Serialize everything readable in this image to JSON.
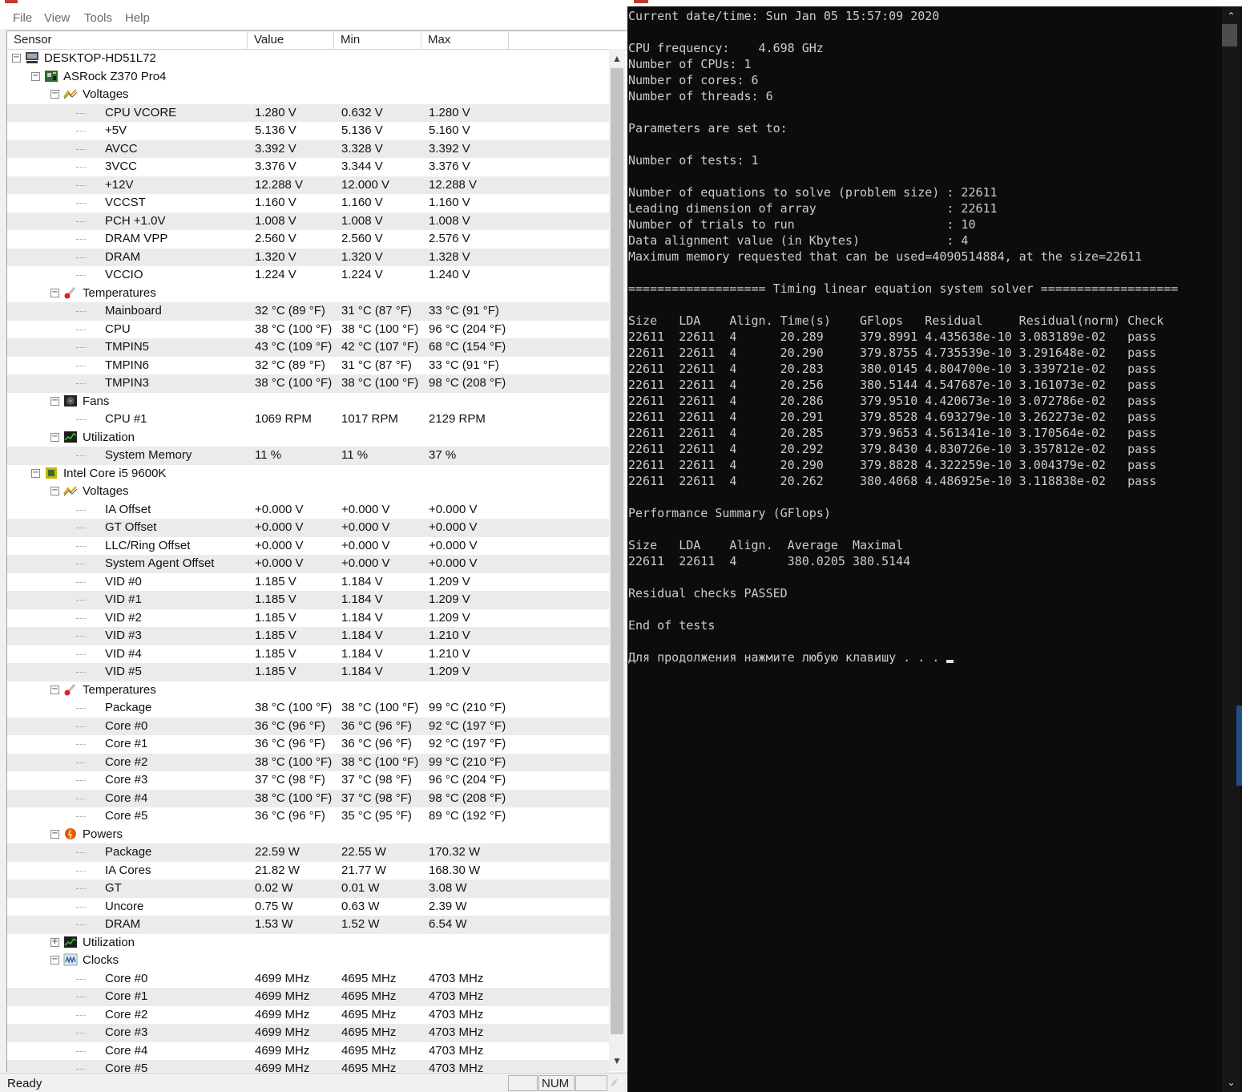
{
  "menu": [
    "File",
    "View",
    "Tools",
    "Help"
  ],
  "columns": [
    "Sensor",
    "Value",
    "Min",
    "Max"
  ],
  "rows": [
    {
      "level": 0,
      "kind": "group",
      "label": "DESKTOP-HD51L72",
      "icon": "computer-icon",
      "expander": "−"
    },
    {
      "level": 1,
      "kind": "group",
      "label": "ASRock Z370 Pro4",
      "icon": "motherboard-icon",
      "expander": "−"
    },
    {
      "level": 2,
      "kind": "group",
      "label": "Voltages",
      "icon": "voltage-icon",
      "expander": "−"
    },
    {
      "level": 3,
      "label": "CPU VCORE",
      "value": "1.280 V",
      "min": "0.632 V",
      "max": "1.280 V"
    },
    {
      "level": 3,
      "label": "+5V",
      "value": "5.136 V",
      "min": "5.136 V",
      "max": "5.160 V"
    },
    {
      "level": 3,
      "label": "AVCC",
      "value": "3.392 V",
      "min": "3.328 V",
      "max": "3.392 V"
    },
    {
      "level": 3,
      "label": "3VCC",
      "value": "3.376 V",
      "min": "3.344 V",
      "max": "3.376 V"
    },
    {
      "level": 3,
      "label": "+12V",
      "value": "12.288 V",
      "min": "12.000 V",
      "max": "12.288 V"
    },
    {
      "level": 3,
      "label": "VCCST",
      "value": "1.160 V",
      "min": "1.160 V",
      "max": "1.160 V"
    },
    {
      "level": 3,
      "label": "PCH +1.0V",
      "value": "1.008 V",
      "min": "1.008 V",
      "max": "1.008 V"
    },
    {
      "level": 3,
      "label": "DRAM VPP",
      "value": "2.560 V",
      "min": "2.560 V",
      "max": "2.576 V"
    },
    {
      "level": 3,
      "label": "DRAM",
      "value": "1.320 V",
      "min": "1.320 V",
      "max": "1.328 V"
    },
    {
      "level": 3,
      "label": "VCCIO",
      "value": "1.224 V",
      "min": "1.224 V",
      "max": "1.240 V"
    },
    {
      "level": 2,
      "kind": "group",
      "label": "Temperatures",
      "icon": "thermometer-icon",
      "expander": "−"
    },
    {
      "level": 3,
      "label": "Mainboard",
      "value": "32 °C  (89 °F)",
      "min": "31 °C  (87 °F)",
      "max": "33 °C  (91 °F)"
    },
    {
      "level": 3,
      "label": "CPU",
      "value": "38 °C  (100 °F)",
      "min": "38 °C  (100 °F)",
      "max": "96 °C  (204 °F)"
    },
    {
      "level": 3,
      "label": "TMPIN5",
      "value": "43 °C  (109 °F)",
      "min": "42 °C  (107 °F)",
      "max": "68 °C  (154 °F)"
    },
    {
      "level": 3,
      "label": "TMPIN6",
      "value": "32 °C  (89 °F)",
      "min": "31 °C  (87 °F)",
      "max": "33 °C  (91 °F)"
    },
    {
      "level": 3,
      "label": "TMPIN3",
      "value": "38 °C  (100 °F)",
      "min": "38 °C  (100 °F)",
      "max": "98 °C  (208 °F)"
    },
    {
      "level": 2,
      "kind": "group",
      "label": "Fans",
      "icon": "fan-icon",
      "expander": "−"
    },
    {
      "level": 3,
      "label": "CPU #1",
      "value": "1069 RPM",
      "min": "1017 RPM",
      "max": "2129 RPM"
    },
    {
      "level": 2,
      "kind": "group",
      "label": "Utilization",
      "icon": "utilization-icon",
      "expander": "−"
    },
    {
      "level": 3,
      "label": "System Memory",
      "value": "11 %",
      "min": "11 %",
      "max": "37 %"
    },
    {
      "level": 1,
      "kind": "group",
      "label": "Intel Core i5 9600K",
      "icon": "cpu-chip-icon",
      "expander": "−"
    },
    {
      "level": 2,
      "kind": "group",
      "label": "Voltages",
      "icon": "voltage-icon",
      "expander": "−"
    },
    {
      "level": 3,
      "label": "IA Offset",
      "value": "+0.000 V",
      "min": "+0.000 V",
      "max": "+0.000 V"
    },
    {
      "level": 3,
      "label": "GT Offset",
      "value": "+0.000 V",
      "min": "+0.000 V",
      "max": "+0.000 V"
    },
    {
      "level": 3,
      "label": "LLC/Ring Offset",
      "value": "+0.000 V",
      "min": "+0.000 V",
      "max": "+0.000 V"
    },
    {
      "level": 3,
      "label": "System Agent Offset",
      "value": "+0.000 V",
      "min": "+0.000 V",
      "max": "+0.000 V"
    },
    {
      "level": 3,
      "label": "VID #0",
      "value": "1.185 V",
      "min": "1.184 V",
      "max": "1.209 V"
    },
    {
      "level": 3,
      "label": "VID #1",
      "value": "1.185 V",
      "min": "1.184 V",
      "max": "1.209 V"
    },
    {
      "level": 3,
      "label": "VID #2",
      "value": "1.185 V",
      "min": "1.184 V",
      "max": "1.209 V"
    },
    {
      "level": 3,
      "label": "VID #3",
      "value": "1.185 V",
      "min": "1.184 V",
      "max": "1.210 V"
    },
    {
      "level": 3,
      "label": "VID #4",
      "value": "1.185 V",
      "min": "1.184 V",
      "max": "1.210 V"
    },
    {
      "level": 3,
      "label": "VID #5",
      "value": "1.185 V",
      "min": "1.184 V",
      "max": "1.209 V"
    },
    {
      "level": 2,
      "kind": "group",
      "label": "Temperatures",
      "icon": "thermometer-icon",
      "expander": "−"
    },
    {
      "level": 3,
      "label": "Package",
      "value": "38 °C  (100 °F)",
      "min": "38 °C  (100 °F)",
      "max": "99 °C  (210 °F)"
    },
    {
      "level": 3,
      "label": "Core #0",
      "value": "36 °C  (96 °F)",
      "min": "36 °C  (96 °F)",
      "max": "92 °C  (197 °F)"
    },
    {
      "level": 3,
      "label": "Core #1",
      "value": "36 °C  (96 °F)",
      "min": "36 °C  (96 °F)",
      "max": "92 °C  (197 °F)"
    },
    {
      "level": 3,
      "label": "Core #2",
      "value": "38 °C  (100 °F)",
      "min": "38 °C  (100 °F)",
      "max": "99 °C  (210 °F)"
    },
    {
      "level": 3,
      "label": "Core #3",
      "value": "37 °C  (98 °F)",
      "min": "37 °C  (98 °F)",
      "max": "96 °C  (204 °F)"
    },
    {
      "level": 3,
      "label": "Core #4",
      "value": "38 °C  (100 °F)",
      "min": "37 °C  (98 °F)",
      "max": "98 °C  (208 °F)"
    },
    {
      "level": 3,
      "label": "Core #5",
      "value": "36 °C  (96 °F)",
      "min": "35 °C  (95 °F)",
      "max": "89 °C  (192 °F)"
    },
    {
      "level": 2,
      "kind": "group",
      "label": "Powers",
      "icon": "power-icon",
      "expander": "−"
    },
    {
      "level": 3,
      "label": "Package",
      "value": "22.59 W",
      "min": "22.55 W",
      "max": "170.32 W"
    },
    {
      "level": 3,
      "label": "IA Cores",
      "value": "21.82 W",
      "min": "21.77 W",
      "max": "168.30 W"
    },
    {
      "level": 3,
      "label": "GT",
      "value": "0.02 W",
      "min": "0.01 W",
      "max": "3.08 W"
    },
    {
      "level": 3,
      "label": "Uncore",
      "value": "0.75 W",
      "min": "0.63 W",
      "max": "2.39 W"
    },
    {
      "level": 3,
      "label": "DRAM",
      "value": "1.53 W",
      "min": "1.52 W",
      "max": "6.54 W"
    },
    {
      "level": 2,
      "kind": "group",
      "label": "Utilization",
      "icon": "utilization-icon",
      "expander": "+"
    },
    {
      "level": 2,
      "kind": "group",
      "label": "Clocks",
      "icon": "clock-wave-icon",
      "expander": "−"
    },
    {
      "level": 3,
      "label": "Core #0",
      "value": "4699 MHz",
      "min": "4695 MHz",
      "max": "4703 MHz"
    },
    {
      "level": 3,
      "label": "Core #1",
      "value": "4699 MHz",
      "min": "4695 MHz",
      "max": "4703 MHz"
    },
    {
      "level": 3,
      "label": "Core #2",
      "value": "4699 MHz",
      "min": "4695 MHz",
      "max": "4703 MHz"
    },
    {
      "level": 3,
      "label": "Core #3",
      "value": "4699 MHz",
      "min": "4695 MHz",
      "max": "4703 MHz"
    },
    {
      "level": 3,
      "label": "Core #4",
      "value": "4699 MHz",
      "min": "4695 MHz",
      "max": "4703 MHz"
    },
    {
      "level": 3,
      "label": "Core #5",
      "value": "4699 MHz",
      "min": "4695 MHz",
      "max": "4703 MHz"
    }
  ],
  "status": {
    "ready": "Ready",
    "num": "NUM"
  },
  "console": {
    "lines": [
      "Current date/time: Sun Jan 05 15:57:09 2020",
      "",
      "CPU frequency:    4.698 GHz",
      "Number of CPUs: 1",
      "Number of cores: 6",
      "Number of threads: 6",
      "",
      "Parameters are set to:",
      "",
      "Number of tests: 1",
      "",
      "Number of equations to solve (problem size) : 22611",
      "Leading dimension of array                  : 22611",
      "Number of trials to run                     : 10",
      "Data alignment value (in Kbytes)            : 4",
      "Maximum memory requested that can be used=4090514884, at the size=22611",
      "",
      "=================== Timing linear equation system solver ===================",
      "",
      "Size   LDA    Align. Time(s)    GFlops   Residual     Residual(norm) Check",
      "22611  22611  4      20.289     379.8991 4.435638e-10 3.083189e-02   pass",
      "22611  22611  4      20.290     379.8755 4.735539e-10 3.291648e-02   pass",
      "22611  22611  4      20.283     380.0145 4.804700e-10 3.339721e-02   pass",
      "22611  22611  4      20.256     380.5144 4.547687e-10 3.161073e-02   pass",
      "22611  22611  4      20.286     379.9510 4.420673e-10 3.072786e-02   pass",
      "22611  22611  4      20.291     379.8528 4.693279e-10 3.262273e-02   pass",
      "22611  22611  4      20.285     379.9653 4.561341e-10 3.170564e-02   pass",
      "22611  22611  4      20.292     379.8430 4.830726e-10 3.357812e-02   pass",
      "22611  22611  4      20.290     379.8828 4.322259e-10 3.004379e-02   pass",
      "22611  22611  4      20.262     380.4068 4.486925e-10 3.118838e-02   pass",
      "",
      "Performance Summary (GFlops)",
      "",
      "Size   LDA    Align.  Average  Maximal",
      "22611  22611  4       380.0205 380.5144",
      "",
      "Residual checks PASSED",
      "",
      "End of tests",
      "",
      "Для продолжения нажмите любую клавишу . . . "
    ]
  }
}
